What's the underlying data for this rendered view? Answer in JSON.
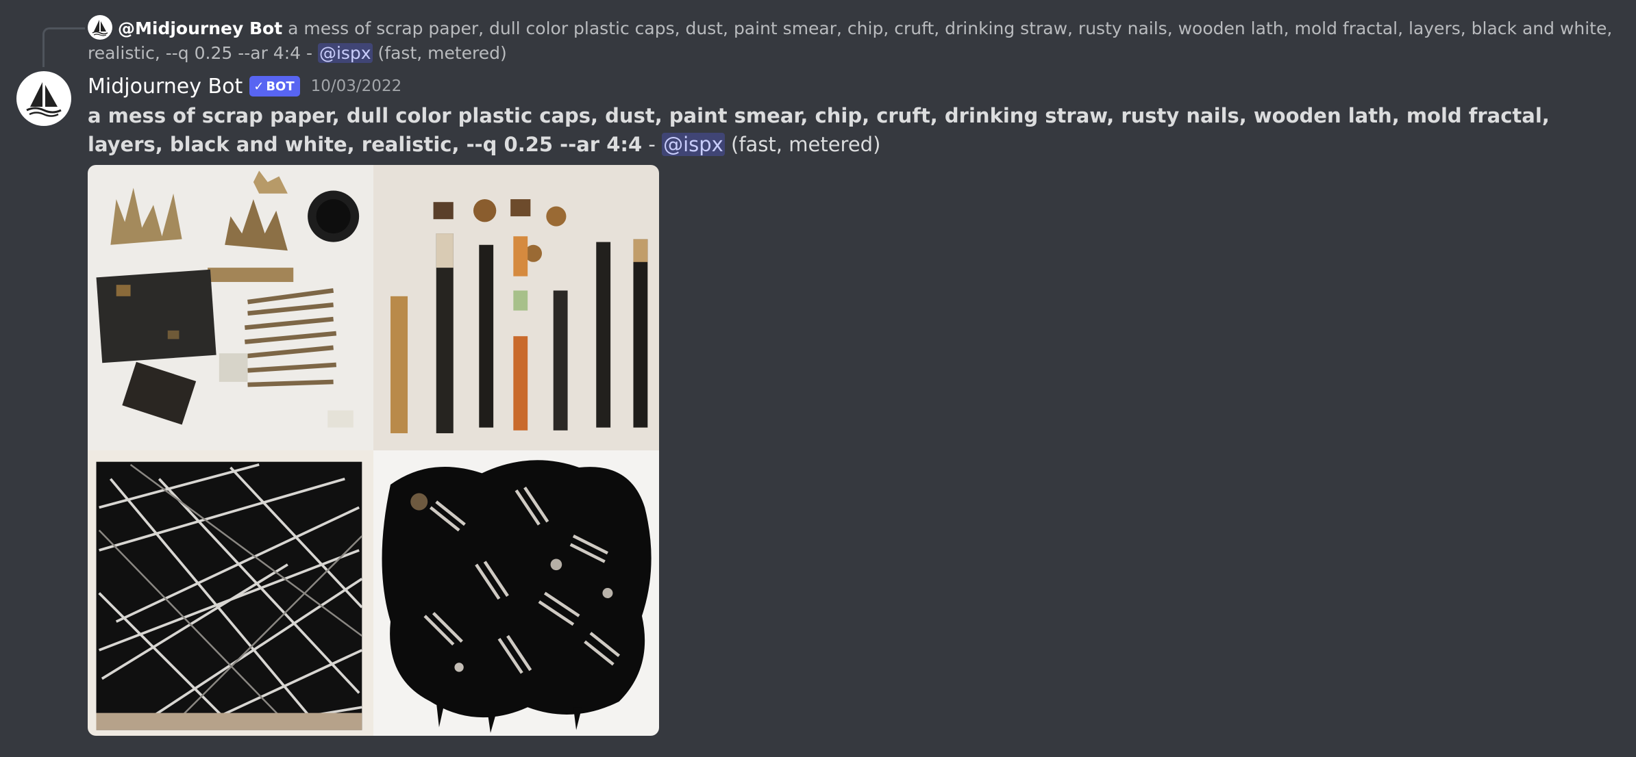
{
  "reply": {
    "author": "@Midjourney Bot",
    "prompt": "a mess of scrap paper, dull color plastic caps, dust, paint smear, chip, cruft, drinking straw, rusty nails, wooden lath, mold fractal, layers, black and white, realistic, --q 0.25 --ar 4:4",
    "separator": " - ",
    "mention": "@ispx",
    "suffix": " (fast, metered)"
  },
  "message": {
    "author": "Midjourney Bot",
    "bot_tag": "BOT",
    "bot_check": "✓",
    "timestamp": "10/03/2022",
    "prompt": "a mess of scrap paper, dull color plastic caps, dust, paint smear, chip, cruft, drinking straw, rusty nails, wooden lath, mold fractal, layers, black and white, realistic, --q 0.25 --ar 4:4",
    "separator": " - ",
    "mention": "@ispx",
    "suffix": " (fast, metered)"
  },
  "images": {
    "count": 4
  },
  "colors": {
    "background": "#36393f",
    "bot_tag": "#5865f2",
    "mention_bg": "rgba(88,101,242,0.3)",
    "text": "#dcddde"
  }
}
